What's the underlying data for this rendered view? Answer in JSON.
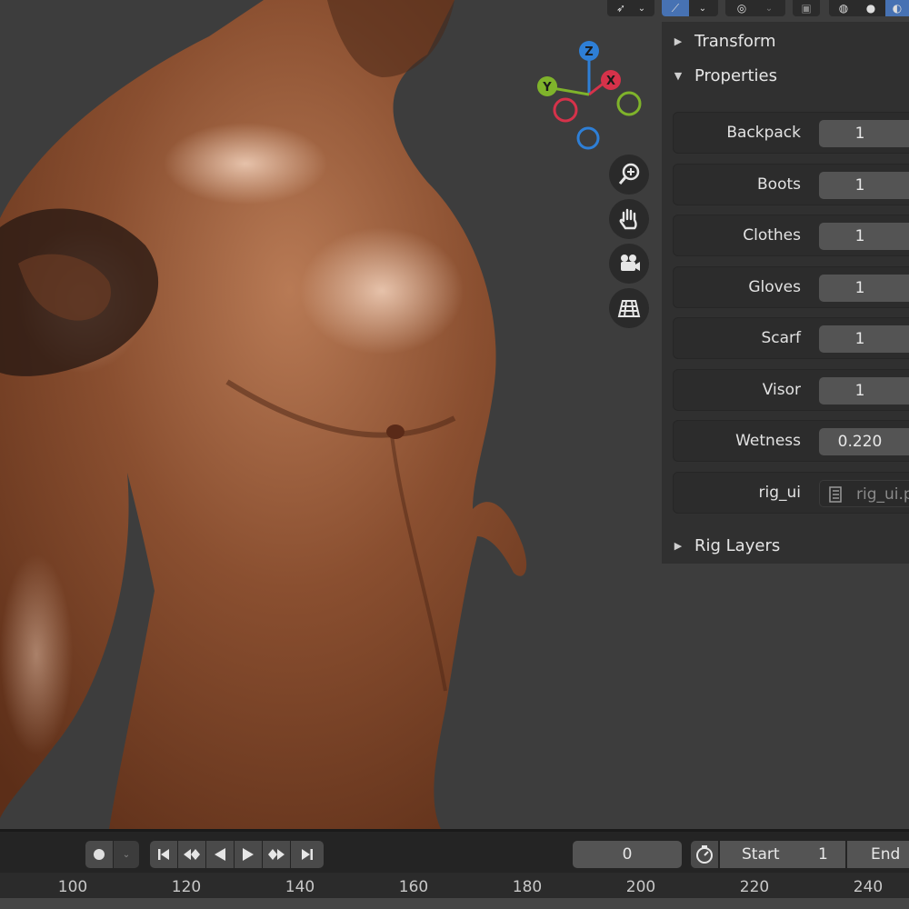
{
  "sidebar": {
    "panels": [
      {
        "label": "Transform",
        "state": "collapsed"
      },
      {
        "label": "Properties",
        "state": "expanded"
      },
      {
        "label": "Rig Layers",
        "state": "collapsed"
      }
    ],
    "properties": [
      {
        "label": "Backpack",
        "value": "1"
      },
      {
        "label": "Boots",
        "value": "1"
      },
      {
        "label": "Clothes",
        "value": "1"
      },
      {
        "label": "Gloves",
        "value": "1"
      },
      {
        "label": "Scarf",
        "value": "1"
      },
      {
        "label": "Visor",
        "value": "1"
      },
      {
        "label": "Wetness",
        "value": "0.220"
      }
    ],
    "text_prop": {
      "label": "rig_ui",
      "value": "rig_ui.py",
      "icon": "text-document-icon"
    }
  },
  "gizmo": {
    "z": "Z",
    "y": "Y",
    "x": "X"
  },
  "nav_buttons": [
    "zoom-icon",
    "pan-hand-icon",
    "camera-icon",
    "ortho-grid-icon"
  ],
  "timeline": {
    "current_frame": "0",
    "start_label": "Start",
    "start_value": "1",
    "end_label": "End",
    "ruler_ticks": [
      "100",
      "120",
      "140",
      "160",
      "180",
      "200",
      "220",
      "240"
    ]
  },
  "colors": {
    "background": "#3d3d3d",
    "panel": "#303030",
    "field": "#545454",
    "accent": "#4772b3",
    "axis_x": "#d6324a",
    "axis_y": "#7fb32b",
    "axis_z": "#2e7fd6"
  }
}
